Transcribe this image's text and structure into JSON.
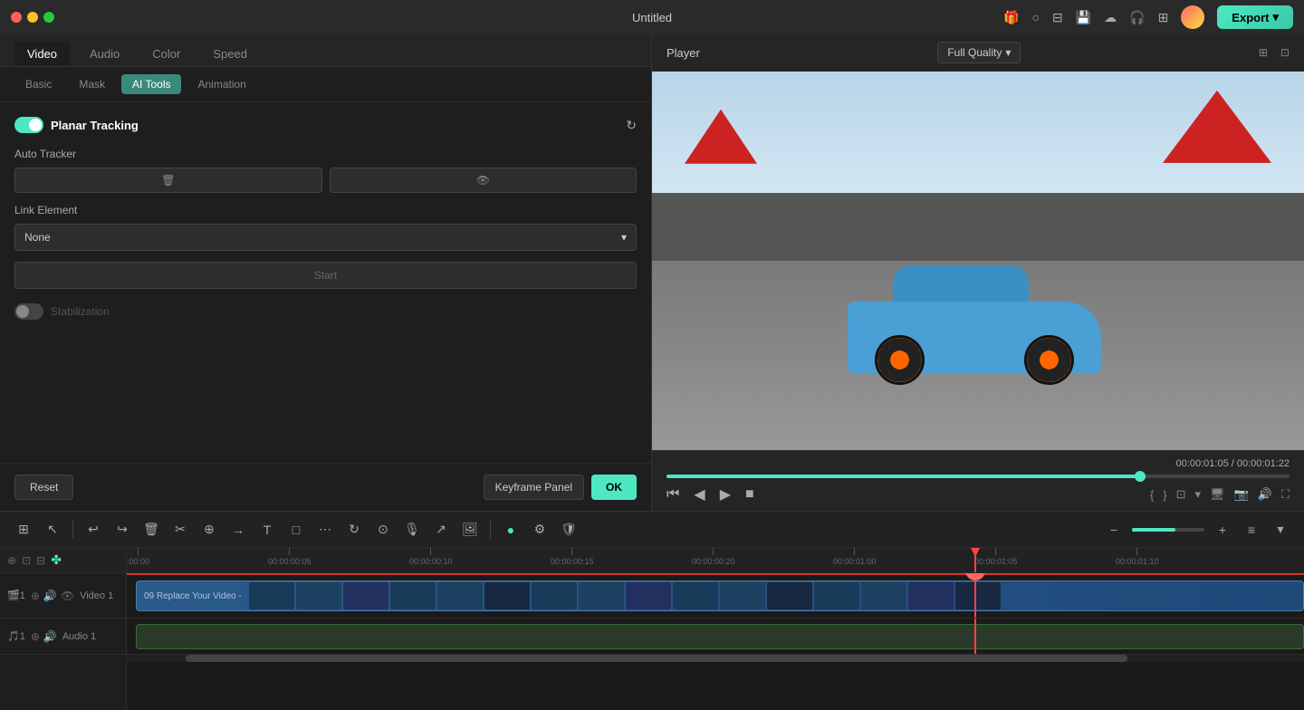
{
  "titlebar": {
    "title": "Untitled",
    "export_label": "Export"
  },
  "left_panel": {
    "top_tabs": [
      "Video",
      "Audio",
      "Color",
      "Speed"
    ],
    "active_top_tab": "Video",
    "sub_tabs": [
      "Basic",
      "Mask",
      "AI Tools",
      "Animation"
    ],
    "active_sub_tab": "AI Tools",
    "section": {
      "title": "Planar Tracking",
      "auto_tracker_label": "Auto Tracker",
      "delete_btn_label": "🗑",
      "eye_btn_label": "👁",
      "link_element_label": "Link Element",
      "link_element_value": "None",
      "start_btn_label": "Start",
      "stabilization_label": "Stabilization"
    },
    "footer": {
      "reset_label": "Reset",
      "keyframe_label": "Keyframe Panel",
      "ok_label": "OK"
    }
  },
  "player": {
    "label": "Player",
    "quality": "Full Quality",
    "current_time": "00:00:01:05",
    "total_time": "00:00:01:22",
    "progress_percent": 76
  },
  "toolbar": {
    "tools": [
      "⊞",
      "↖",
      "↩",
      "↪",
      "🗑",
      "✂",
      "⊕",
      "→",
      "T",
      "□",
      "⋯",
      "↻",
      "⊙",
      "→",
      "⊕",
      "⊗",
      "⋯"
    ],
    "zoom_minus": "−",
    "zoom_plus": "+"
  },
  "timeline": {
    "ruler_marks": [
      {
        "label": ":00:00",
        "pos_percent": 0
      },
      {
        "label": "00:00:00:05",
        "pos_percent": 12
      },
      {
        "label": "00:00:00:10",
        "pos_percent": 24
      },
      {
        "label": "00:00:00:15",
        "pos_percent": 36
      },
      {
        "label": "00:00:00:20",
        "pos_percent": 48
      },
      {
        "label": "00:00:01:00",
        "pos_percent": 60
      },
      {
        "label": "00:00:01:05",
        "pos_percent": 72
      },
      {
        "label": "00:00:01:10",
        "pos_percent": 84
      }
    ],
    "playhead_percent": 72,
    "video_track": {
      "name": "Video 1",
      "clip_label": "09 Replace Your Video -"
    },
    "audio_track": {
      "name": "Audio 1"
    }
  }
}
